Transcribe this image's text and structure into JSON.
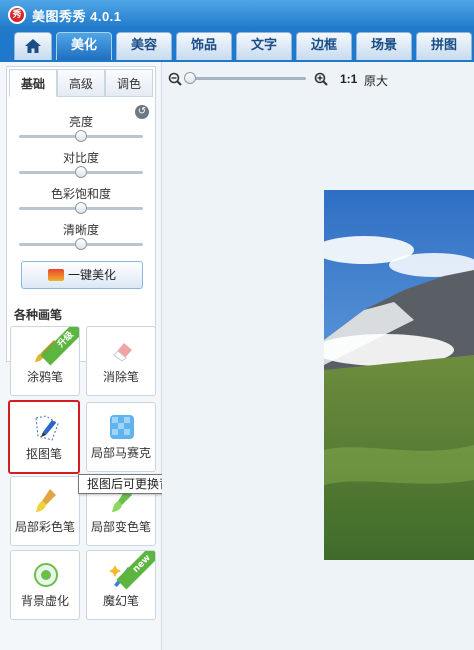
{
  "app": {
    "logo_text": "秀",
    "title": "美图秀秀 4.0.1"
  },
  "tabs": [
    {
      "label": "美化"
    },
    {
      "label": "美容"
    },
    {
      "label": "饰品"
    },
    {
      "label": "文字"
    },
    {
      "label": "边框"
    },
    {
      "label": "场景"
    },
    {
      "label": "拼图"
    }
  ],
  "subtabs": [
    {
      "label": "基础"
    },
    {
      "label": "高级"
    },
    {
      "label": "调色"
    }
  ],
  "adjustments": [
    {
      "label": "亮度",
      "value": 0.5
    },
    {
      "label": "对比度",
      "value": 0.5
    },
    {
      "label": "色彩饱和度",
      "value": 0.5
    },
    {
      "label": "清晰度",
      "value": 0.5
    }
  ],
  "onekey_label": "一键美化",
  "brushes": {
    "section_title": "各种画笔",
    "items": [
      {
        "label": "涂鸦笔",
        "badge": "升级"
      },
      {
        "label": "消除笔"
      },
      {
        "label": "抠图笔",
        "selected": true
      },
      {
        "label": "局部马赛克"
      },
      {
        "label": "局部彩色笔"
      },
      {
        "label": "局部变色笔"
      },
      {
        "label": "背景虚化"
      },
      {
        "label": "魔幻笔",
        "badge": "new"
      }
    ]
  },
  "tooltip": "抠图后可更换背景、合成图片",
  "zoom": {
    "ratio_label": "1:1",
    "original_label": "原大",
    "value": 0.0
  }
}
